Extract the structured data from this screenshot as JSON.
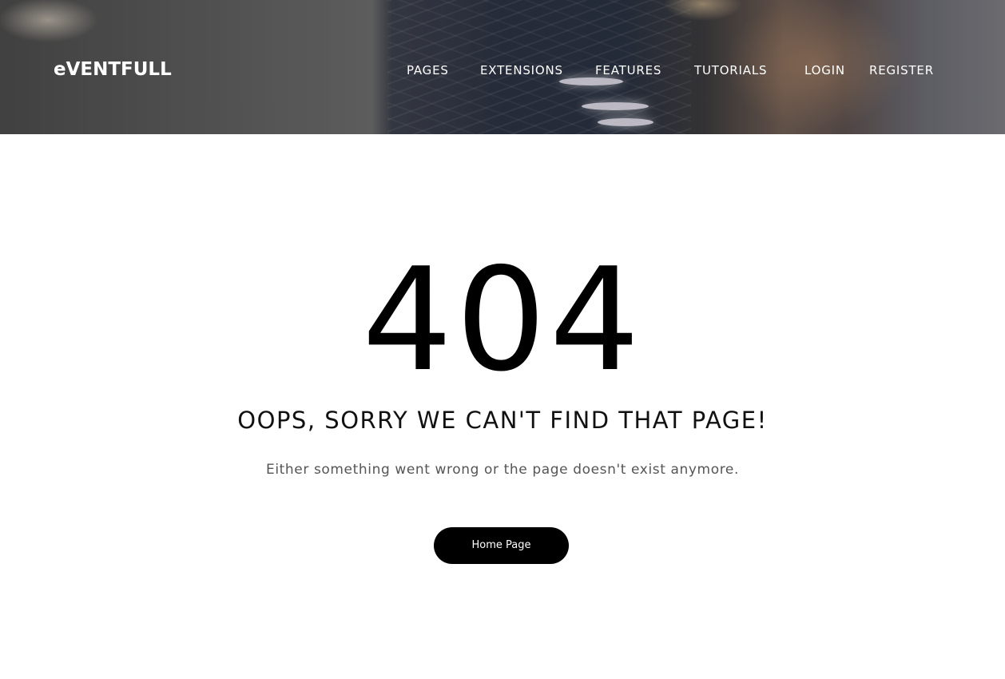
{
  "header": {
    "logo_text": "eVENTFULL",
    "nav": {
      "pages": "PAGES",
      "extensions": "EXTENSIONS",
      "features": "FEATURES",
      "tutorials": "TUTORIALS",
      "login": "LOGIN",
      "register": "REGISTER"
    }
  },
  "error": {
    "code": "404",
    "headline": "OOPS, SORRY WE CAN'T FIND THAT PAGE!",
    "message": "Either something went wrong or the page doesn't exist anymore.",
    "button_label": "Home Page"
  },
  "colors": {
    "button_bg": "#000000",
    "text_dark": "#000000",
    "text_muted": "#555555",
    "nav_text": "#ffffff"
  }
}
